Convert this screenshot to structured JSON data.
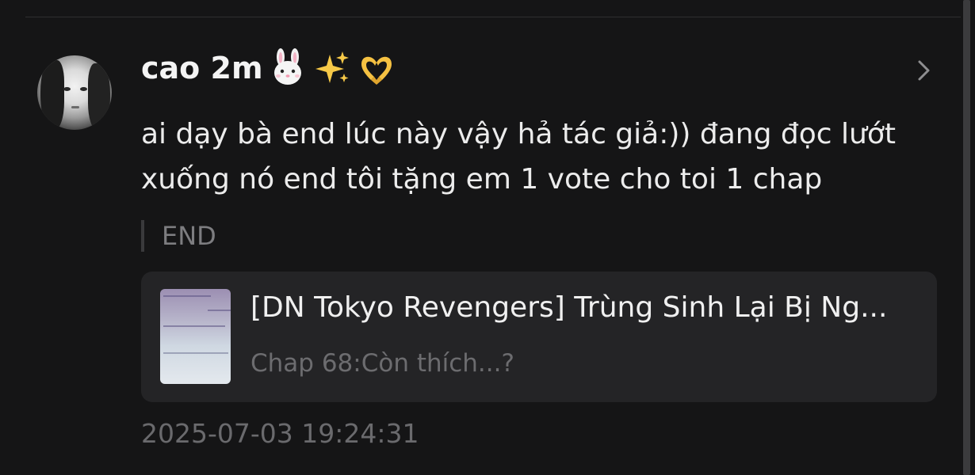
{
  "comment": {
    "username": "cao 2m",
    "username_emojis": [
      "rabbit-face-emoji",
      "sparkles-emoji",
      "heart-hands-emoji"
    ],
    "text": "ai dạy bà end lúc này vậy hả tác giả:)) đang đọc lướt xuống nó end tôi tặng em 1 vote cho toi 1 chap",
    "quoted_text": "END",
    "timestamp": "2025-07-03 19:24:31"
  },
  "book": {
    "title": "[DN Tokyo Revengers] Trùng Sinh Lại Bị Ng...",
    "chapter": "Chap 68:Còn thích...?"
  },
  "icons": {
    "open_detail": "chevron-right-icon"
  },
  "colors": {
    "background": "#151516",
    "card": "#242426",
    "primary_text": "#f4f4f4",
    "secondary_text": "#6c6c6f"
  }
}
